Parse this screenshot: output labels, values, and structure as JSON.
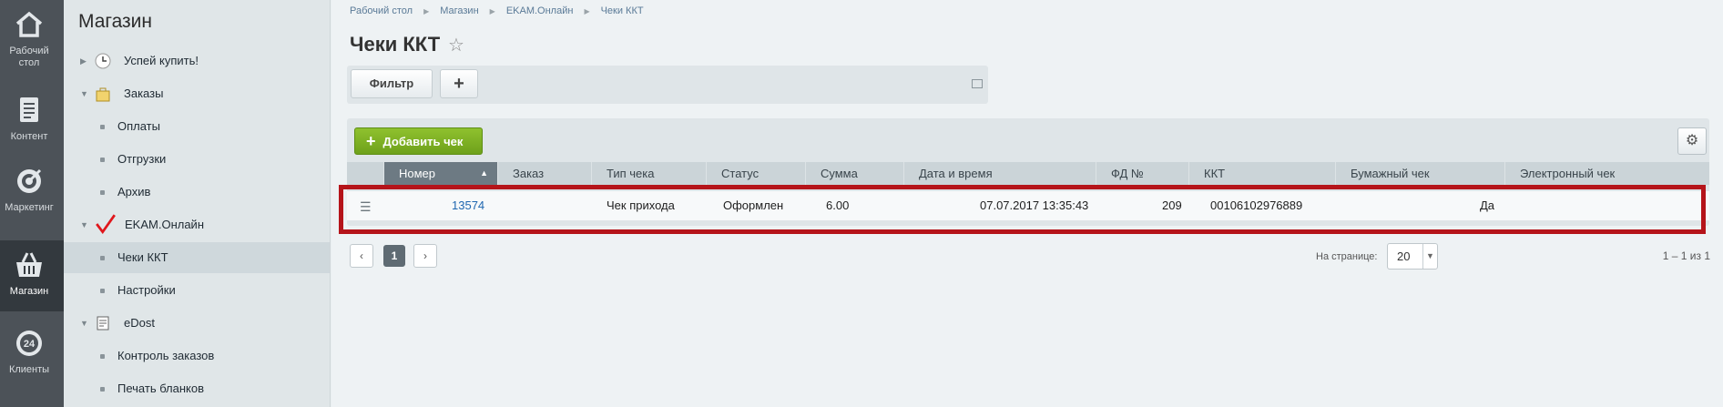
{
  "rail": [
    {
      "label_1": "Рабочий",
      "label_2": "стол",
      "icon": "home-icon"
    },
    {
      "label_1": "Контент",
      "label_2": "",
      "icon": "document-icon"
    },
    {
      "label_1": "Маркетинг",
      "label_2": "",
      "icon": "target-icon"
    },
    {
      "label_1": "Магазин",
      "label_2": "",
      "icon": "basket-icon",
      "active": true
    },
    {
      "label_1": "Клиенты",
      "label_2": "",
      "icon": "clients-24-icon"
    }
  ],
  "menu": {
    "title": "Магазин",
    "items": [
      {
        "label": "Успей купить!",
        "level": 0,
        "icon": "clock-icon"
      },
      {
        "label": "Заказы",
        "level": 0,
        "icon": "bag-icon"
      },
      {
        "label": "Оплаты",
        "level": 1
      },
      {
        "label": "Отгрузки",
        "level": 1
      },
      {
        "label": "Архив",
        "level": 1
      },
      {
        "label": "EKAM.Онлайн",
        "level": 0,
        "icon": "checkmark-icon"
      },
      {
        "label": "Чеки ККТ",
        "level": 1,
        "selected": true
      },
      {
        "label": "Настройки",
        "level": 1
      },
      {
        "label": "eDost",
        "level": 0,
        "icon": "edost-icon"
      },
      {
        "label": "Контроль заказов",
        "level": 1
      },
      {
        "label": "Печать бланков",
        "level": 1
      }
    ]
  },
  "breadcrumbs": [
    "Рабочий стол",
    "Магазин",
    "EKAM.Онлайн",
    "Чеки ККТ"
  ],
  "page_title": "Чеки ККТ",
  "filter_button": "Фильтр",
  "plus_button": "+",
  "add_button": "Добавить чек",
  "columns": [
    "Номер",
    "Заказ",
    "Тип чека",
    "Статус",
    "Сумма",
    "Дата и время",
    "ФД №",
    "ККТ",
    "Бумажный чек",
    "Электронный чек"
  ],
  "rows": [
    {
      "number": "13574",
      "order": "",
      "type": "Чек прихода",
      "status": "Оформлен",
      "sum": "6.00",
      "datetime": "07.07.2017 13:35:43",
      "fd": "209",
      "kkt": "00106102976889",
      "paper": "Да",
      "electronic": ""
    }
  ],
  "pager": {
    "prev": "‹",
    "current": "1",
    "next": "›",
    "per_page_label": "На странице:",
    "per_page_value": "20",
    "total": "1 – 1 из 1"
  },
  "colors": {
    "highlight": "#b5141a",
    "add_button": "#7cb024",
    "link": "#2067b0",
    "sorted_header": "#6d7a83"
  }
}
